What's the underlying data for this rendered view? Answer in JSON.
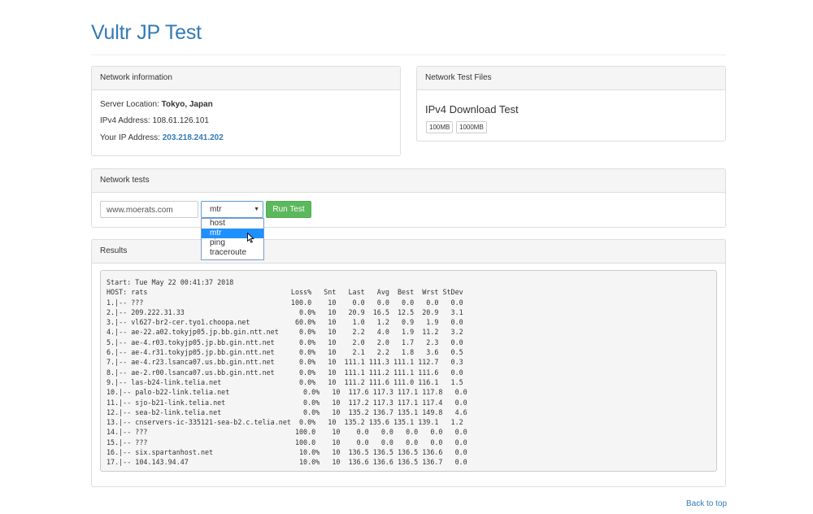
{
  "page": {
    "title": "Vultr JP Test"
  },
  "network_info": {
    "heading": "Network information",
    "server_location_label": "Server Location:",
    "server_location_value": "Tokyo, Japan",
    "ipv4_label": "IPv4 Address:",
    "ipv4_value": "108.61.126.101",
    "your_ip_label": "Your IP Address:",
    "your_ip_value": "203.218.241.202"
  },
  "test_files": {
    "heading": "Network Test Files",
    "ipv4_title": "IPv4 Download Test",
    "buttons": [
      "100MB",
      "1000MB"
    ]
  },
  "network_tests": {
    "heading": "Network tests",
    "host_value": "www.moerats.com",
    "selected_tool": "mtr",
    "options": [
      "host",
      "mtr",
      "ping",
      "traceroute"
    ],
    "run_label": "Run Test",
    "colors": {
      "run_button": "#5cb85c",
      "selected_option": "#1e90ff"
    },
    "icons": {
      "select_arrow": "caret-down-icon",
      "cursor": "mouse-pointer-icon"
    }
  },
  "results": {
    "heading": "Results",
    "lines": [
      "Start: Tue May 22 00:41:37 2018",
      "HOST: rats                                   Loss%   Snt   Last   Avg  Best  Wrst StDev",
      "1.|-- ???                                    100.0    10    0.0   0.0   0.0   0.0   0.0",
      "2.|-- 209.222.31.33                            0.0%   10   20.9  16.5  12.5  20.9   3.1",
      "3.|-- vl627-br2-cer.tyo1.choopa.net           60.0%   10    1.0   1.2   0.9   1.9   0.0",
      "4.|-- ae-22.a02.tokyjp05.jp.bb.gin.ntt.net     0.0%   10    2.2   4.0   1.9  11.2   3.2",
      "5.|-- ae-4.r03.tokyjp05.jp.bb.gin.ntt.net      0.0%   10    2.0   2.0   1.7   2.3   0.0",
      "6.|-- ae-4.r31.tokyjp05.jp.bb.gin.ntt.net      0.0%   10    2.1   2.2   1.8   3.6   0.5",
      "7.|-- ae-4.r23.lsanca07.us.bb.gin.ntt.net      0.0%   10  111.1 111.3 111.1 112.7   0.3",
      "8.|-- ae-2.r00.lsanca07.us.bb.gin.ntt.net      0.0%   10  111.1 111.2 111.1 111.6   0.0",
      "9.|-- las-b24-link.telia.net                   0.0%   10  111.2 111.6 111.0 116.1   1.5",
      "10.|-- palo-b22-link.telia.net                  0.0%   10  117.6 117.3 117.1 117.8   0.0",
      "11.|-- sjo-b21-link.telia.net                   0.0%   10  117.2 117.3 117.1 117.4   0.0",
      "12.|-- sea-b2-link.telia.net                    0.0%   10  135.2 136.7 135.1 149.8   4.6",
      "13.|-- cnservers-ic-335121-sea-b2.c.telia.net  0.0%   10  135.2 135.6 135.1 139.1   1.2",
      "14.|-- ???                                    100.0    10    0.0   0.0   0.0   0.0   0.0",
      "15.|-- ???                                    100.0    10    0.0   0.0   0.0   0.0   0.0",
      "16.|-- six.spartanhost.net                     10.0%   10  136.5 136.5 136.5 136.6   0.0",
      "17.|-- 104.143.94.47                           10.0%   10  136.6 136.6 136.5 136.7   0.0"
    ]
  },
  "footer": {
    "back_to_top": "Back to top"
  }
}
